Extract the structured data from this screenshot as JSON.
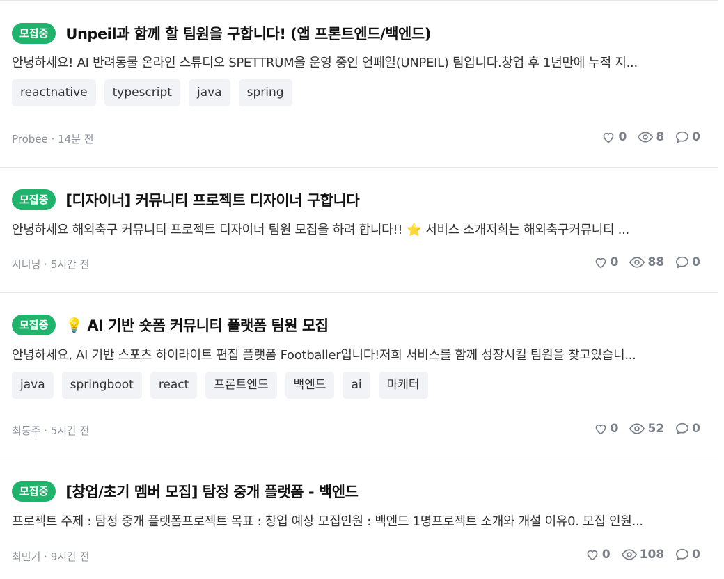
{
  "posts": [
    {
      "badge": "모집중",
      "title": "Unpeil과 함께 할 팀원을 구합니다! (앱 프론트엔드/백엔드)",
      "description": "안녕하세요! AI 반려동물 온라인 스튜디오 SPETTRUM을 운영 중인 언페일(UNPEIL) 팀입니다.창업 후 1년만에 누적 지...",
      "tags": [
        "reactnative",
        "typescript",
        "java",
        "spring"
      ],
      "author": "Probee",
      "time": "14분 전",
      "likes": "0",
      "views": "8",
      "comments": "0"
    },
    {
      "badge": "모집중",
      "title": "[디자이너] 커뮤니티 프로젝트 디자이너 구합니다",
      "description": "안녕하세요 해외축구 커뮤니티 프로젝트 디자이너 팀원 모집을 하려 합니다!! ⭐ 서비스 소개저희는 해외축구커뮤니티 ...",
      "tags": [],
      "author": "시니닝",
      "time": "5시간 전",
      "likes": "0",
      "views": "88",
      "comments": "0"
    },
    {
      "badge": "모집중",
      "title_emoji": "💡",
      "title": "AI 기반 숏폼 커뮤니티 플랫폼 팀원 모집",
      "description": "안녕하세요, AI 기반 스포츠 하이라이트 편집 플랫폼 Footballer입니다!저희 서비스를 함께 성장시킬 팀원을 찾고있습니...",
      "tags": [
        "java",
        "springboot",
        "react",
        "프론트엔드",
        "백엔드",
        "ai",
        "마케터"
      ],
      "author": "최동주",
      "time": "5시간 전",
      "likes": "0",
      "views": "52",
      "comments": "0"
    },
    {
      "badge": "모집중",
      "title": "[창업/초기 멤버 모집] 탐정 중개 플랫폼 - 백엔드",
      "description": "프로젝트 주제 : 탐정 중개 플랫폼프로젝트 목표 : 창업 예상 모집인원 : 백엔드 1명프로젝트 소개와 개설 이유0. 모집 인원...",
      "tags": [],
      "author": "최민기",
      "time": "9시간 전",
      "likes": "0",
      "views": "108",
      "comments": "0"
    }
  ],
  "icons": {
    "like": "heart-icon",
    "view": "eye-icon",
    "comment": "comment-icon"
  },
  "colors": {
    "badge": "#1fb36b",
    "tag_bg": "#f1f3f6",
    "meta": "#8a8f98"
  }
}
